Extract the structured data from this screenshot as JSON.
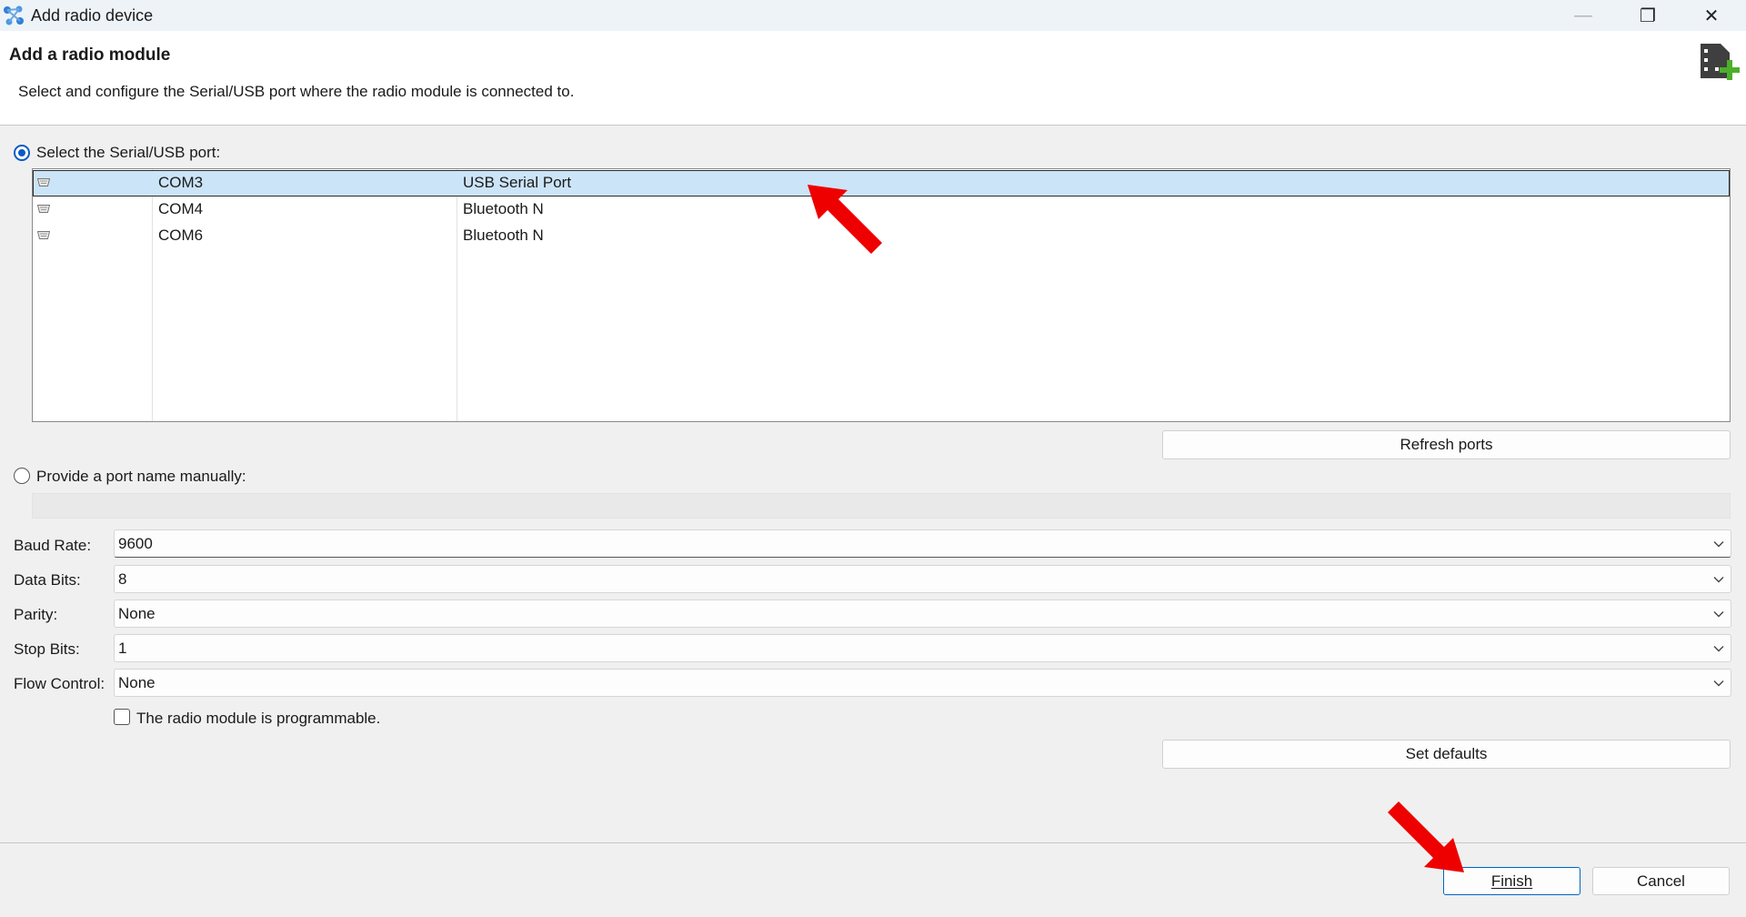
{
  "window": {
    "title": "Add radio device",
    "minimize_glyph": "—",
    "restore_glyph": "❐",
    "close_glyph": "✕"
  },
  "header": {
    "title": "Add a radio module",
    "subtitle": "Select and configure the Serial/USB port where the radio module is connected to.",
    "icon": "radio-module-add-icon"
  },
  "port_selection": {
    "radio_serial_label": "Select the Serial/USB port:",
    "radio_serial_checked": true,
    "ports": [
      {
        "name": "COM3",
        "description": "USB Serial Port",
        "selected": true
      },
      {
        "name": "COM4",
        "description": "Bluetooth N",
        "selected": false
      },
      {
        "name": "COM6",
        "description": "Bluetooth N",
        "selected": false
      }
    ],
    "refresh_label": "Refresh ports",
    "radio_manual_label": "Provide a port name manually:",
    "radio_manual_checked": false,
    "manual_value": ""
  },
  "settings": {
    "baud_rate_label": "Baud Rate:",
    "baud_rate_value": "9600",
    "data_bits_label": "Data Bits:",
    "data_bits_value": "8",
    "parity_label": "Parity:",
    "parity_value": "None",
    "stop_bits_label": "Stop Bits:",
    "stop_bits_value": "1",
    "flow_control_label": "Flow Control:",
    "flow_control_value": "None",
    "programmable_label": "The radio module is programmable.",
    "programmable_checked": false,
    "set_defaults_label": "Set defaults"
  },
  "footer": {
    "finish_label": "Finish",
    "cancel_label": "Cancel"
  },
  "annotations": {
    "arrow_color": "#ee0000"
  }
}
